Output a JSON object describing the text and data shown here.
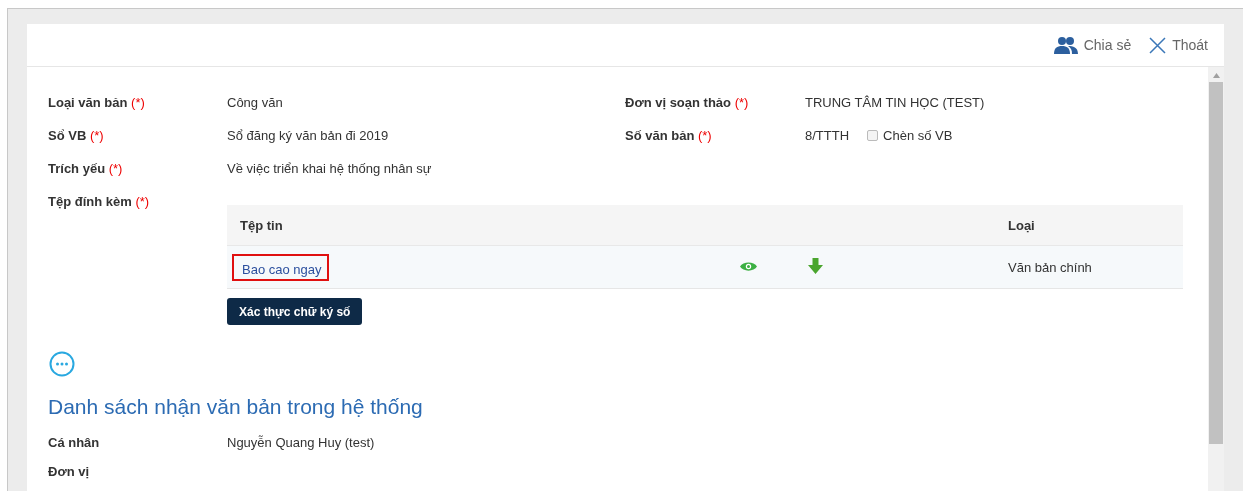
{
  "header_actions": [
    {
      "kind": "share",
      "label": "Chia sẻ"
    },
    {
      "kind": "close",
      "label": "Thoát"
    }
  ],
  "left_fields": [
    {
      "label": "Loại văn bản",
      "required_mark": "(*)",
      "value": "Công văn"
    },
    {
      "label": "Sổ VB",
      "required_mark": "(*)",
      "value": "Sổ đăng ký văn bản đi 2019"
    },
    {
      "label": "Trích yếu",
      "required_mark": "(*)",
      "value": "Về việc triển khai hệ thống nhân sự"
    },
    {
      "label": "Tệp đính kèm",
      "required_mark": "(*)"
    }
  ],
  "right_fields": [
    {
      "label": "Đơn vị soạn thảo",
      "required_mark": "(*)",
      "value": "TRUNG TÂM TIN HỌC (TEST)"
    },
    {
      "label": "Số văn bản",
      "required_mark": "(*)",
      "value": "8/TTTH",
      "checkbox": {
        "label": "Chèn số VB",
        "checked": false
      }
    }
  ],
  "attachments": {
    "columns": [
      "Tệp tin",
      "Loại"
    ],
    "rows": [
      {
        "name": "Bao cao ngay",
        "highlighted": true,
        "type": "Văn bản chính"
      }
    ]
  },
  "verify_button": "Xác thực chữ ký số",
  "recipients": {
    "title": "Danh sách nhận văn bản trong hệ thống",
    "fields": [
      {
        "label": "Cá nhân",
        "value": "Nguyễn Quang Huy (test)"
      },
      {
        "label": "Đơn vị"
      }
    ]
  }
}
